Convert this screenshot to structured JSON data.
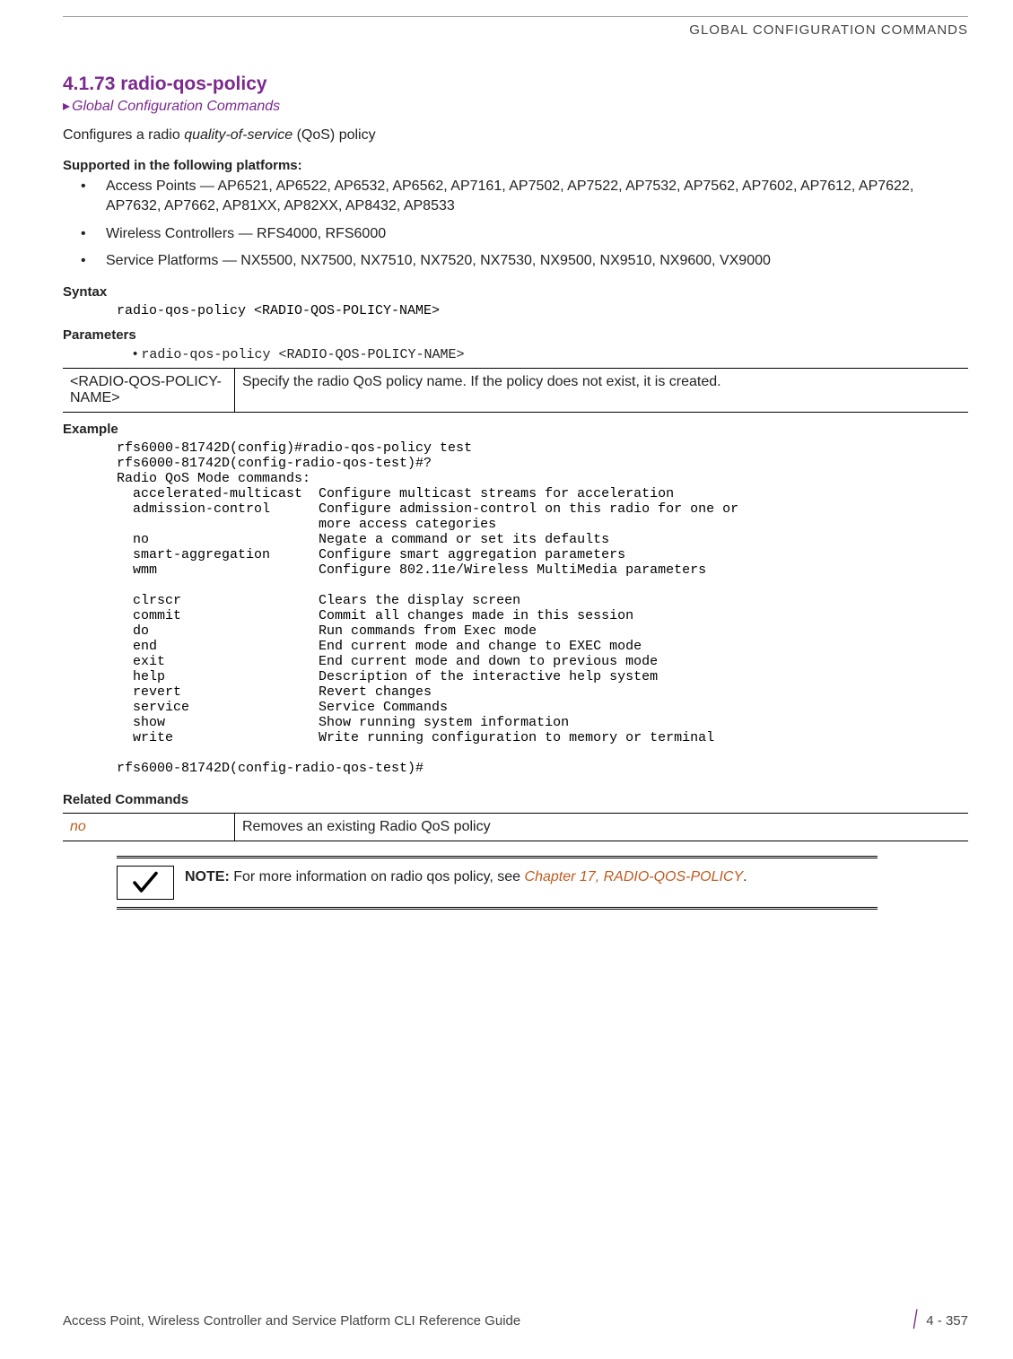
{
  "running_head": "GLOBAL CONFIGURATION COMMANDS",
  "section": {
    "number": "4.1.73",
    "title": "radio-qos-policy",
    "breadcrumb": "Global Configuration Commands",
    "desc_pre": "Configures a radio ",
    "desc_ital": "quality-of-service",
    "desc_post": " (QoS) policy"
  },
  "supported_head": "Supported in the following platforms:",
  "platforms": [
    "Access Points — AP6521, AP6522, AP6532, AP6562, AP7161, AP7502, AP7522, AP7532, AP7562, AP7602, AP7612, AP7622, AP7632, AP7662, AP81XX, AP82XX, AP8432, AP8533",
    "Wireless Controllers — RFS4000, RFS6000",
    "Service Platforms — NX5500, NX7500, NX7510, NX7520, NX7530, NX9500, NX9510, NX9600, VX9000"
  ],
  "syntax_head": "Syntax",
  "syntax_code": "radio-qos-policy <RADIO-QOS-POLICY-NAME>",
  "parameters_head": "Parameters",
  "parameters_line": "radio-qos-policy <RADIO-QOS-POLICY-NAME>",
  "param_table": {
    "name": "<RADIO-QOS-POLICY-NAME>",
    "desc": "Specify the radio QoS policy name. If the policy does not exist, it is created."
  },
  "example_head": "Example",
  "example_code": "rfs6000-81742D(config)#radio-qos-policy test\nrfs6000-81742D(config-radio-qos-test)#?\nRadio QoS Mode commands:\n  accelerated-multicast  Configure multicast streams for acceleration\n  admission-control      Configure admission-control on this radio for one or\n                         more access categories\n  no                     Negate a command or set its defaults\n  smart-aggregation      Configure smart aggregation parameters\n  wmm                    Configure 802.11e/Wireless MultiMedia parameters\n\n  clrscr                 Clears the display screen\n  commit                 Commit all changes made in this session\n  do                     Run commands from Exec mode\n  end                    End current mode and change to EXEC mode\n  exit                   End current mode and down to previous mode\n  help                   Description of the interactive help system\n  revert                 Revert changes\n  service                Service Commands\n  show                   Show running system information\n  write                  Write running configuration to memory or terminal\n\nrfs6000-81742D(config-radio-qos-test)#",
  "related_head": "Related Commands",
  "related": {
    "cmd": "no",
    "desc": "Removes an existing Radio QoS policy"
  },
  "note": {
    "label": "NOTE:",
    "text_pre": " For more information on radio qos policy, see ",
    "link": "Chapter 17, RADIO-QOS-POLICY",
    "text_post": "."
  },
  "footer": {
    "doc": "Access Point, Wireless Controller and Service Platform CLI Reference Guide",
    "page": "4 - 357"
  }
}
